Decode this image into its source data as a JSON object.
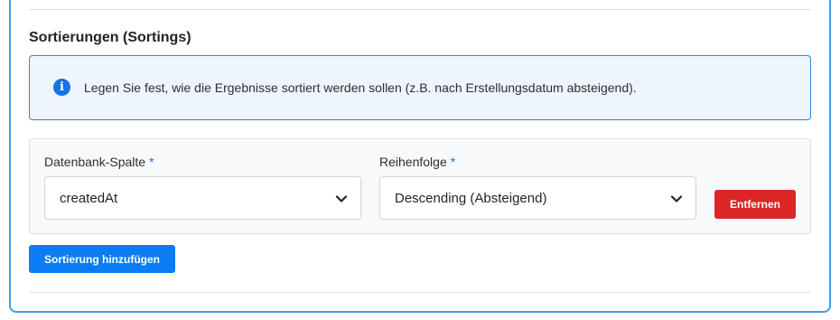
{
  "section": {
    "title": "Sortierungen (Sortings)"
  },
  "info": {
    "icon": "info-icon",
    "text": "Legen Sie fest, wie die Ergebnisse sortiert werden sollen (z.B. nach Erstellungsdatum absteigend)."
  },
  "sort_row": {
    "column": {
      "label": "Datenbank-Spalte",
      "required_marker": "*",
      "value": "createdAt"
    },
    "order": {
      "label": "Reihenfolge",
      "required_marker": "*",
      "value": "Descending (Absteigend)"
    },
    "remove_label": "Entfernen"
  },
  "add_button_label": "Sortierung hinzufügen",
  "colors": {
    "panel_border": "#3aa0f0",
    "info_bg": "#eef5fc",
    "info_border": "#2f86d6",
    "primary": "#0b7cf3",
    "danger": "#dc2626",
    "required": "#1473e6"
  }
}
